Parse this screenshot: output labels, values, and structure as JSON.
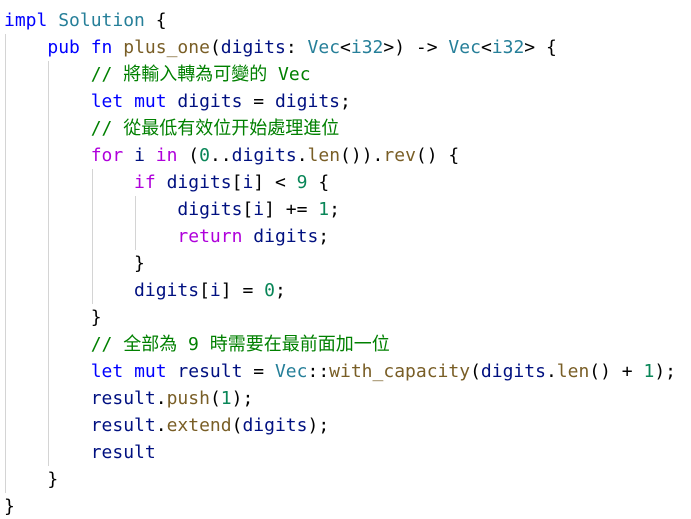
{
  "editor": {
    "language": "rust",
    "colors": {
      "background": "#ffffff",
      "keyword": "#0000ff",
      "control": "#af00db",
      "type": "#267f99",
      "function": "#795e26",
      "variable": "#001080",
      "number": "#098658",
      "comment": "#008000",
      "punctuation": "#000000",
      "indent_guide": "#d4d4d4"
    },
    "lines": [
      {
        "indent": "",
        "tokens": [
          {
            "t": "kw",
            "v": "impl"
          },
          {
            "t": "pn",
            "v": " "
          },
          {
            "t": "ty",
            "v": "Solution"
          },
          {
            "t": "pn",
            "v": " {"
          }
        ]
      },
      {
        "indent": "    ",
        "tokens": [
          {
            "t": "kw",
            "v": "pub"
          },
          {
            "t": "pn",
            "v": " "
          },
          {
            "t": "kw",
            "v": "fn"
          },
          {
            "t": "pn",
            "v": " "
          },
          {
            "t": "fn",
            "v": "plus_one"
          },
          {
            "t": "pn",
            "v": "("
          },
          {
            "t": "var",
            "v": "digits"
          },
          {
            "t": "pn",
            "v": ": "
          },
          {
            "t": "ty",
            "v": "Vec"
          },
          {
            "t": "pn",
            "v": "<"
          },
          {
            "t": "ty",
            "v": "i32"
          },
          {
            "t": "pn",
            "v": ">) -> "
          },
          {
            "t": "ty",
            "v": "Vec"
          },
          {
            "t": "pn",
            "v": "<"
          },
          {
            "t": "ty",
            "v": "i32"
          },
          {
            "t": "pn",
            "v": "> {"
          }
        ]
      },
      {
        "indent": "        ",
        "tokens": [
          {
            "t": "cm",
            "v": "// 將輸入轉為可變的 Vec"
          }
        ]
      },
      {
        "indent": "        ",
        "tokens": [
          {
            "t": "kw",
            "v": "let"
          },
          {
            "t": "pn",
            "v": " "
          },
          {
            "t": "kw",
            "v": "mut"
          },
          {
            "t": "pn",
            "v": " "
          },
          {
            "t": "var",
            "v": "digits"
          },
          {
            "t": "pn",
            "v": " = "
          },
          {
            "t": "var",
            "v": "digits"
          },
          {
            "t": "pn",
            "v": ";"
          }
        ]
      },
      {
        "indent": "        ",
        "tokens": [
          {
            "t": "cm",
            "v": "// 從最低有效位开始處理進位"
          }
        ]
      },
      {
        "indent": "        ",
        "tokens": [
          {
            "t": "ctl",
            "v": "for"
          },
          {
            "t": "pn",
            "v": " "
          },
          {
            "t": "var",
            "v": "i"
          },
          {
            "t": "pn",
            "v": " "
          },
          {
            "t": "ctl",
            "v": "in"
          },
          {
            "t": "pn",
            "v": " ("
          },
          {
            "t": "num",
            "v": "0"
          },
          {
            "t": "pn",
            "v": ".."
          },
          {
            "t": "var",
            "v": "digits"
          },
          {
            "t": "pn",
            "v": "."
          },
          {
            "t": "fn",
            "v": "len"
          },
          {
            "t": "pn",
            "v": "())."
          },
          {
            "t": "fn",
            "v": "rev"
          },
          {
            "t": "pn",
            "v": "() {"
          }
        ]
      },
      {
        "indent": "            ",
        "tokens": [
          {
            "t": "ctl",
            "v": "if"
          },
          {
            "t": "pn",
            "v": " "
          },
          {
            "t": "var",
            "v": "digits"
          },
          {
            "t": "pn",
            "v": "["
          },
          {
            "t": "var",
            "v": "i"
          },
          {
            "t": "pn",
            "v": "] < "
          },
          {
            "t": "num",
            "v": "9"
          },
          {
            "t": "pn",
            "v": " {"
          }
        ]
      },
      {
        "indent": "                ",
        "tokens": [
          {
            "t": "var",
            "v": "digits"
          },
          {
            "t": "pn",
            "v": "["
          },
          {
            "t": "var",
            "v": "i"
          },
          {
            "t": "pn",
            "v": "] += "
          },
          {
            "t": "num",
            "v": "1"
          },
          {
            "t": "pn",
            "v": ";"
          }
        ]
      },
      {
        "indent": "                ",
        "tokens": [
          {
            "t": "ctl",
            "v": "return"
          },
          {
            "t": "pn",
            "v": " "
          },
          {
            "t": "var",
            "v": "digits"
          },
          {
            "t": "pn",
            "v": ";"
          }
        ]
      },
      {
        "indent": "            ",
        "tokens": [
          {
            "t": "pn",
            "v": "}"
          }
        ]
      },
      {
        "indent": "            ",
        "tokens": [
          {
            "t": "var",
            "v": "digits"
          },
          {
            "t": "pn",
            "v": "["
          },
          {
            "t": "var",
            "v": "i"
          },
          {
            "t": "pn",
            "v": "] = "
          },
          {
            "t": "num",
            "v": "0"
          },
          {
            "t": "pn",
            "v": ";"
          }
        ]
      },
      {
        "indent": "        ",
        "tokens": [
          {
            "t": "pn",
            "v": "}"
          }
        ]
      },
      {
        "indent": "        ",
        "tokens": [
          {
            "t": "cm",
            "v": "// 全部為 9 時需要在最前面加一位"
          }
        ]
      },
      {
        "indent": "        ",
        "tokens": [
          {
            "t": "kw",
            "v": "let"
          },
          {
            "t": "pn",
            "v": " "
          },
          {
            "t": "kw",
            "v": "mut"
          },
          {
            "t": "pn",
            "v": " "
          },
          {
            "t": "var",
            "v": "result"
          },
          {
            "t": "pn",
            "v": " = "
          },
          {
            "t": "ty",
            "v": "Vec"
          },
          {
            "t": "pn",
            "v": "::"
          },
          {
            "t": "fn",
            "v": "with_capacity"
          },
          {
            "t": "pn",
            "v": "("
          },
          {
            "t": "var",
            "v": "digits"
          },
          {
            "t": "pn",
            "v": "."
          },
          {
            "t": "fn",
            "v": "len"
          },
          {
            "t": "pn",
            "v": "() + "
          },
          {
            "t": "num",
            "v": "1"
          },
          {
            "t": "pn",
            "v": ");"
          }
        ]
      },
      {
        "indent": "        ",
        "tokens": [
          {
            "t": "var",
            "v": "result"
          },
          {
            "t": "pn",
            "v": "."
          },
          {
            "t": "fn",
            "v": "push"
          },
          {
            "t": "pn",
            "v": "("
          },
          {
            "t": "num",
            "v": "1"
          },
          {
            "t": "pn",
            "v": ");"
          }
        ]
      },
      {
        "indent": "        ",
        "tokens": [
          {
            "t": "var",
            "v": "result"
          },
          {
            "t": "pn",
            "v": "."
          },
          {
            "t": "fn",
            "v": "extend"
          },
          {
            "t": "pn",
            "v": "("
          },
          {
            "t": "var",
            "v": "digits"
          },
          {
            "t": "pn",
            "v": ");"
          }
        ]
      },
      {
        "indent": "        ",
        "tokens": [
          {
            "t": "var",
            "v": "result"
          }
        ]
      },
      {
        "indent": "    ",
        "tokens": [
          {
            "t": "pn",
            "v": "}"
          }
        ]
      },
      {
        "indent": "",
        "tokens": [
          {
            "t": "pn",
            "v": "}"
          }
        ]
      }
    ]
  }
}
